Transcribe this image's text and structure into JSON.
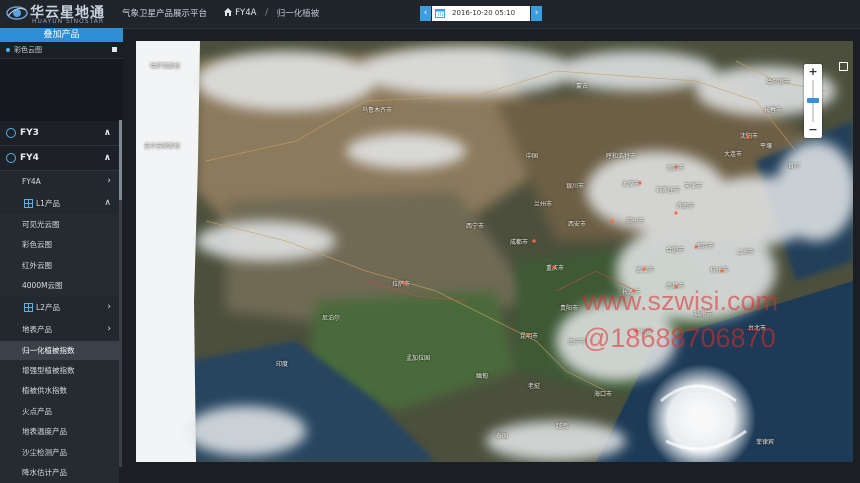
{
  "header": {
    "logo_text": "华云星地通",
    "logo_sub": "HUAYUN SINOSTAR",
    "breadcrumb": [
      "气象卫星产品展示平台",
      "FY4A",
      "归一化植被"
    ],
    "time_value": "2016-10-20 05:10",
    "prev_label": "‹",
    "next_label": "›"
  },
  "sidebar": {
    "overlay_title": "叠加产品",
    "overlay_item": "彩色云图",
    "menu": [
      {
        "kind": "group",
        "label": "FY3",
        "chev": "∧"
      },
      {
        "kind": "group",
        "label": "FY4",
        "chev": "∧"
      },
      {
        "kind": "sub",
        "label": "FY4A",
        "chev": "›"
      },
      {
        "kind": "subhead",
        "label": "L1产品",
        "chev": "∧"
      },
      {
        "kind": "leaf",
        "label": "可见光云图"
      },
      {
        "kind": "leaf",
        "label": "彩色云图"
      },
      {
        "kind": "leaf",
        "label": "红外云图"
      },
      {
        "kind": "leaf",
        "label": "4000M云图"
      },
      {
        "kind": "subhead",
        "label": "L2产品",
        "chev": "›"
      },
      {
        "kind": "sub",
        "label": "地表产品",
        "chev": "›"
      },
      {
        "kind": "leaf",
        "label": "归一化植被指数",
        "selected": true
      },
      {
        "kind": "leaf",
        "label": "增强型植被指数"
      },
      {
        "kind": "leaf",
        "label": "植被供水指数"
      },
      {
        "kind": "leaf",
        "label": "火点产品"
      },
      {
        "kind": "leaf",
        "label": "地表温度产品"
      },
      {
        "kind": "leaf",
        "label": "沙尘检测产品"
      },
      {
        "kind": "leaf",
        "label": "降水估计产品"
      }
    ]
  },
  "map": {
    "zoom_in": "+",
    "zoom_out": "−",
    "labels": [
      "哈萨克斯坦",
      "乌鲁木齐市",
      "蒙古",
      "吉尔吉斯斯坦",
      "中国",
      "西宁市",
      "兰州市",
      "银川市",
      "呼和浩特市",
      "北京市",
      "天津市",
      "石家庄市",
      "太原市",
      "济南市",
      "郑州市",
      "西安市",
      "成都市",
      "重庆市",
      "武汉市",
      "合肥市",
      "南京市",
      "上海市",
      "杭州市",
      "长沙市",
      "南昌市",
      "福州市",
      "台北市",
      "广州市",
      "海口市",
      "南宁市",
      "昆明市",
      "贵阳市",
      "拉萨市",
      "沈阳市",
      "长春市",
      "哈尔滨市",
      "大连市",
      "首尔",
      "平壤",
      "印度",
      "尼泊尔",
      "孟加拉国",
      "缅甸",
      "老挝",
      "越南",
      "泰国",
      "菲律宾"
    ]
  },
  "watermark": {
    "line1": "www.szwisi.com",
    "line2": "@18688706870"
  }
}
